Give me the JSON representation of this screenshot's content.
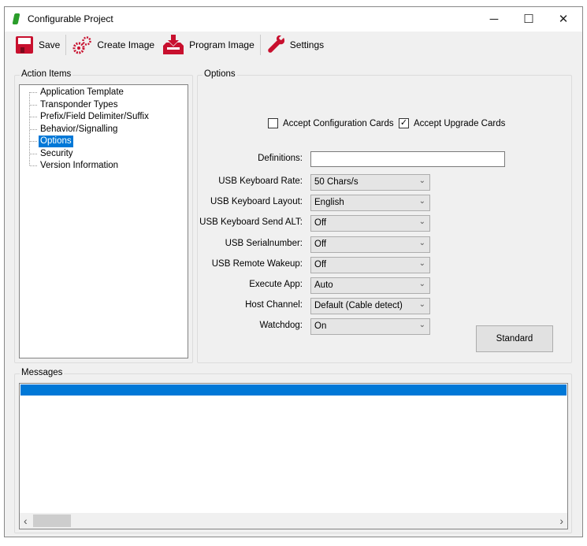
{
  "window": {
    "title": "Configurable Project",
    "controls": {
      "minimize": "─",
      "maximize": "☐",
      "close": "✕"
    }
  },
  "toolbar": {
    "save": "Save",
    "create_image": "Create Image",
    "program_image": "Program Image",
    "settings": "Settings"
  },
  "action_items": {
    "label": "Action Items",
    "items": [
      "Application Template",
      "Transponder Types",
      "Prefix/Field Delimiter/Suffix",
      "Behavior/Signalling",
      "Options",
      "Security",
      "Version Information"
    ],
    "selected": "Options"
  },
  "options": {
    "label": "Options",
    "accept_config_cards": {
      "label": "Accept Configuration Cards",
      "checked": false
    },
    "accept_upgrade_cards": {
      "label": "Accept Upgrade Cards",
      "checked": true
    },
    "definitions": {
      "label": "Definitions:",
      "value": ""
    },
    "fields": [
      {
        "label": "USB Keyboard Rate:",
        "value": "50 Chars/s"
      },
      {
        "label": "USB Keyboard Layout:",
        "value": "English"
      },
      {
        "label": "USB Keyboard Send ALT:",
        "value": "Off"
      },
      {
        "label": "USB Serialnumber:",
        "value": "Off"
      },
      {
        "label": "USB Remote Wakeup:",
        "value": "Off"
      },
      {
        "label": "Execute App:",
        "value": "Auto"
      },
      {
        "label": "Host Channel:",
        "value": "Default (Cable detect)"
      },
      {
        "label": "Watchdog:",
        "value": "On"
      }
    ],
    "standard_button": "Standard"
  },
  "messages": {
    "label": "Messages",
    "scroll_left": "‹",
    "scroll_right": "›"
  },
  "colors": {
    "selection": "#0078d7",
    "accent_red": "#c8102e"
  }
}
